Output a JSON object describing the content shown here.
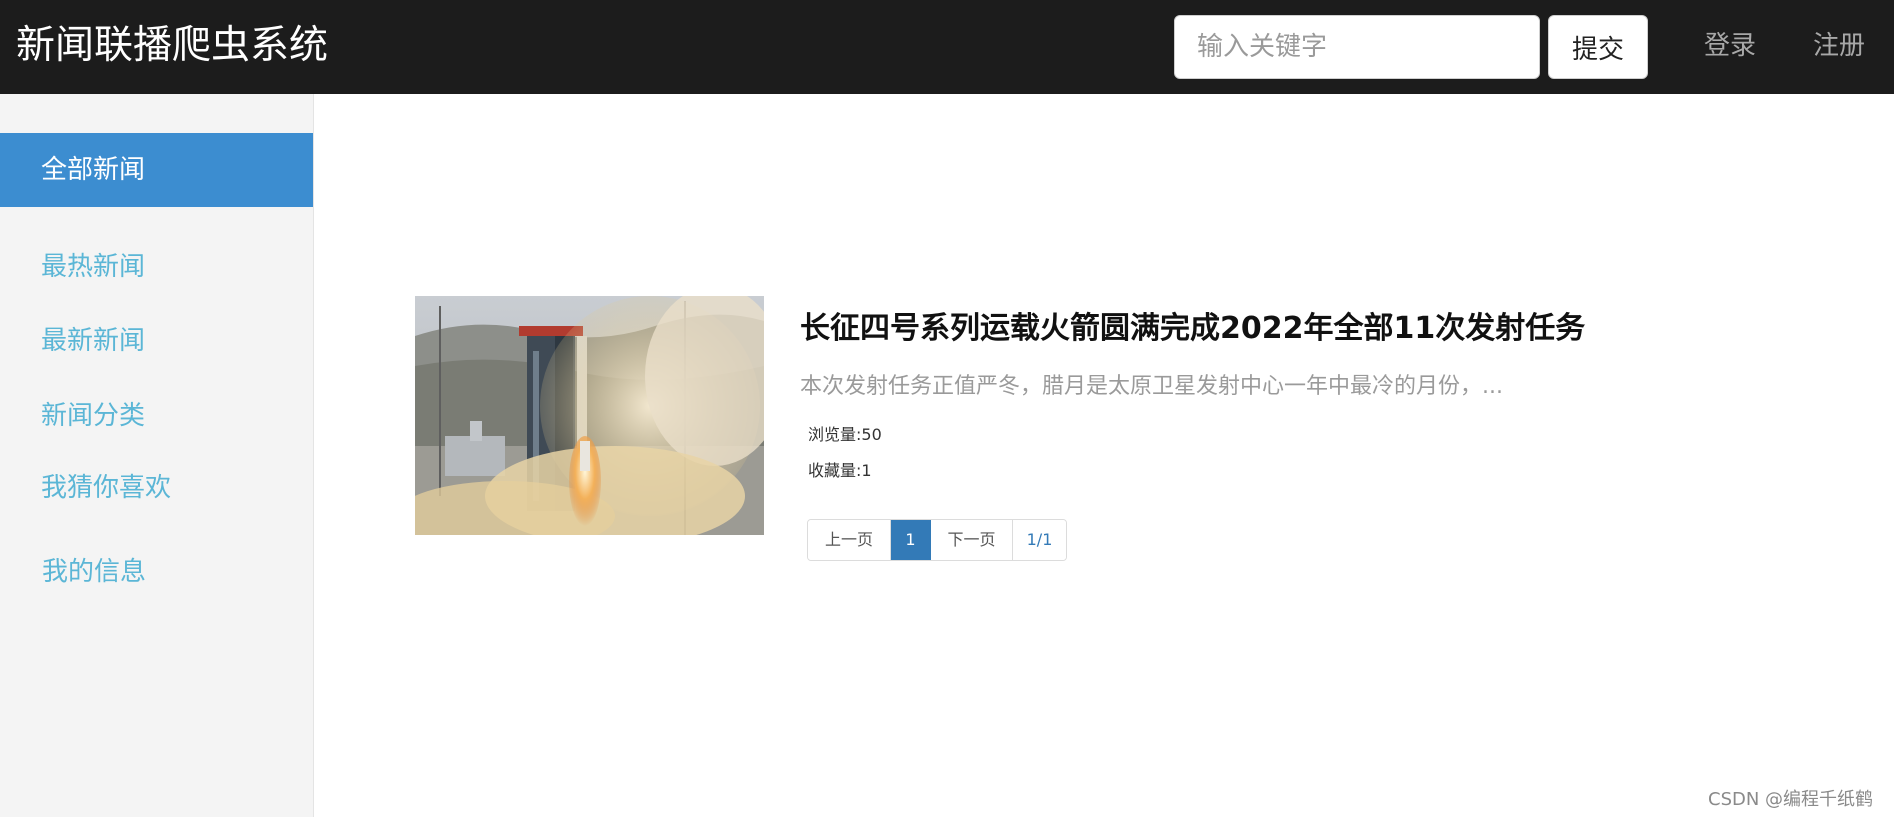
{
  "header": {
    "brand": "新闻联播爬虫系统",
    "search": {
      "placeholder": "输入关键字",
      "value": ""
    },
    "submit_label": "提交",
    "login_label": "登录",
    "register_label": "注册"
  },
  "sidebar": {
    "items": [
      {
        "label": "全部新闻",
        "active": true
      },
      {
        "label": "最热新闻",
        "active": false
      },
      {
        "label": "最新新闻",
        "active": false
      },
      {
        "label": "新闻分类",
        "active": false
      },
      {
        "label": "我猜你喜欢",
        "active": false
      },
      {
        "label": "我的信息",
        "active": false
      }
    ]
  },
  "news": [
    {
      "title": "长征四号系列运载火箭圆满完成2022年全部11次发射任务",
      "summary": "本次发射任务正值严冬，腊月是太原卫星发射中心一年中最冷的月份，...",
      "views_label": "浏览量:50",
      "favorites_label": "收藏量:1"
    }
  ],
  "pagination": {
    "prev_label": "上一页",
    "current_page": "1",
    "next_label": "下一页",
    "page_info": "1/1"
  },
  "watermark": "CSDN @编程千纸鹤",
  "colors": {
    "topbar": "#1c1c1c",
    "sidebar_active": "#3c8dd0",
    "sidebar_link": "#5bb6d6",
    "pagination_active": "#337ab7"
  }
}
